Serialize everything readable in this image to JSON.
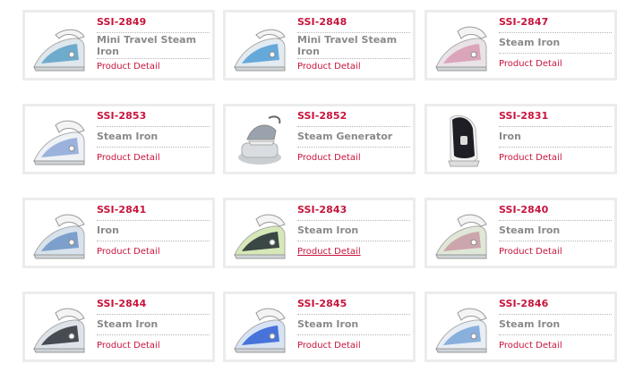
{
  "colors": {
    "code": "#c8143c",
    "name": "#8a8a8a",
    "border": "#ececec"
  },
  "products": [
    {
      "code": "SSI-2849",
      "name": "Mini Travel Steam Iron",
      "detail": "Product Detail",
      "accent": "#5aa0c8",
      "body": "#dfe6ec",
      "style": "travel"
    },
    {
      "code": "SSI-2848",
      "name": "Mini Travel Steam Iron",
      "detail": "Product Detail",
      "accent": "#4f9ed6",
      "body": "#e3ebf1",
      "style": "travel"
    },
    {
      "code": "SSI-2847",
      "name": "Steam Iron",
      "detail": "Product Detail",
      "accent": "#d79ab3",
      "body": "#e9e3e7",
      "style": "iron"
    },
    {
      "code": "SSI-2853",
      "name": "Steam Iron",
      "detail": "Product Detail",
      "accent": "#8ca7d8",
      "body": "#eef1f5",
      "style": "iron"
    },
    {
      "code": "SSI-2852",
      "name": "Steam Generator",
      "detail": "Product Detail",
      "accent": "#9aa3ad",
      "body": "#d9dde2",
      "style": "generator"
    },
    {
      "code": "SSI-2831",
      "name": "Iron",
      "detail": "Product Detail",
      "accent": "#1e1e24",
      "body": "#f1f1f1",
      "style": "upright"
    },
    {
      "code": "SSI-2841",
      "name": "Iron",
      "detail": "Product Detail",
      "accent": "#6c94c6",
      "body": "#d8e2ec",
      "style": "iron"
    },
    {
      "code": "SSI-2843",
      "name": "Steam Iron",
      "detail": "Product Detail",
      "accent": "#1f2a30",
      "body": "#d7e8b8",
      "style": "iron"
    },
    {
      "code": "SSI-2840",
      "name": "Steam Iron",
      "detail": "Product Detail",
      "accent": "#c99aa5",
      "body": "#dfe7d7",
      "style": "iron"
    },
    {
      "code": "SSI-2844",
      "name": "Steam Iron",
      "detail": "Product Detail",
      "accent": "#2b3136",
      "body": "#dde3e8",
      "style": "iron"
    },
    {
      "code": "SSI-2845",
      "name": "Steam Iron",
      "detail": "Product Detail",
      "accent": "#2e5fd6",
      "body": "#d7e3f3",
      "style": "iron"
    },
    {
      "code": "SSI-2846",
      "name": "Steam Iron",
      "detail": "Product Detail",
      "accent": "#78a5d8",
      "body": "#e9eef5",
      "style": "iron"
    }
  ]
}
